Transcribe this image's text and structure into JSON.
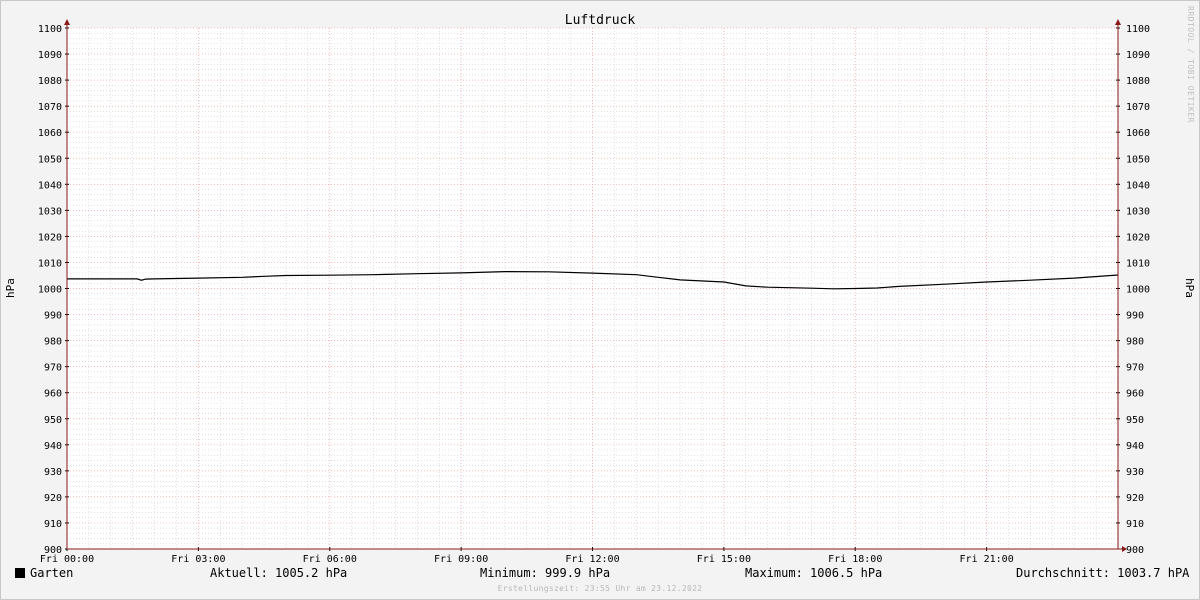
{
  "chart_data": {
    "type": "line",
    "title": "Luftdruck",
    "ylabel": "hPa",
    "ylabel_right": "hPa",
    "ylim": [
      900,
      1100
    ],
    "y_ticks": [
      900,
      910,
      920,
      930,
      940,
      950,
      960,
      970,
      980,
      990,
      1000,
      1010,
      1020,
      1030,
      1040,
      1050,
      1060,
      1070,
      1080,
      1090,
      1100
    ],
    "x_range_hours": [
      0,
      24
    ],
    "x_ticks": [
      {
        "hour": 0,
        "label": "Fri 00:00"
      },
      {
        "hour": 3,
        "label": "Fri 03:00"
      },
      {
        "hour": 6,
        "label": "Fri 06:00"
      },
      {
        "hour": 9,
        "label": "Fri 09:00"
      },
      {
        "hour": 12,
        "label": "Fri 12:00"
      },
      {
        "hour": 15,
        "label": "Fri 15:00"
      },
      {
        "hour": 18,
        "label": "Fri 18:00"
      },
      {
        "hour": 21,
        "label": "Fri 21:00"
      }
    ],
    "grid": true,
    "series": [
      {
        "name": "Garten",
        "color": "#000000",
        "x_hours": [
          0,
          1,
          1.6,
          1.7,
          1.8,
          2,
          3,
          4,
          4.5,
          5,
          6,
          7,
          8,
          9,
          10,
          11,
          12,
          13,
          13.5,
          14,
          15,
          15.5,
          16,
          16.5,
          17,
          17.5,
          18,
          18.5,
          19,
          20,
          21,
          22,
          23,
          24
        ],
        "values": [
          1003.7,
          1003.7,
          1003.7,
          1003.2,
          1003.6,
          1003.7,
          1004.0,
          1004.3,
          1004.7,
          1005.0,
          1005.1,
          1005.3,
          1005.7,
          1006.0,
          1006.5,
          1006.4,
          1005.9,
          1005.3,
          1004.3,
          1003.3,
          1002.5,
          1001.0,
          1000.5,
          1000.3,
          1000.1,
          999.9,
          1000.0,
          1000.2,
          1000.8,
          1001.6,
          1002.5,
          1003.2,
          1004.0,
          1005.2
        ]
      }
    ]
  },
  "legend": {
    "label": "Garten",
    "color": "#000000"
  },
  "stats": {
    "current": "Aktuell: 1005.2 hPa",
    "minimum": "Minimum: 999.9 hPa",
    "maximum": "Maximum: 1006.5 hPa",
    "average": "Durchschnitt: 1003.7 hPA"
  },
  "created_text": "Erstellungszeit: 23:55 Uhr am 23.12.2022",
  "watermark": "RRDTOOL / TOBI OETIKER",
  "colors": {
    "background": "#f3f3f3",
    "plot_background": "#ffffff",
    "major_grid": "#f2a0a0",
    "minor_grid": "#cfcfcf",
    "axis": "#8b1a1a"
  }
}
